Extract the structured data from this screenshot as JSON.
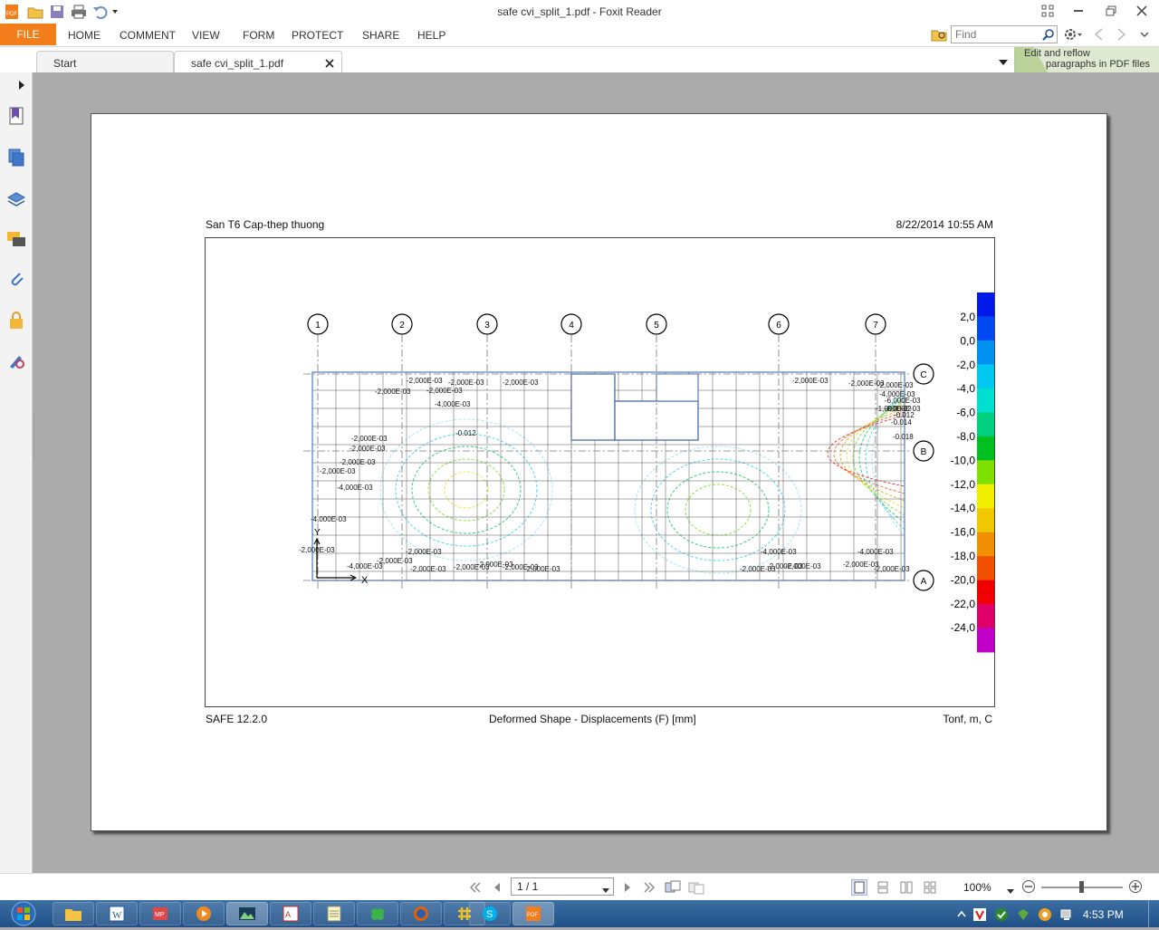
{
  "window": {
    "title": "safe cvi_split_1.pdf - Foxit Reader"
  },
  "menu": {
    "file": "FILE",
    "items": [
      "HOME",
      "COMMENT",
      "VIEW",
      "FORM",
      "PROTECT",
      "SHARE",
      "HELP"
    ],
    "find_placeholder": "Find"
  },
  "tabs": [
    {
      "label": "Start"
    },
    {
      "label": "safe cvi_split_1.pdf"
    }
  ],
  "reflow_hint": {
    "line1": "Edit and reflow",
    "line2": "paragraphs in PDF files"
  },
  "left_nav_icons": [
    "bookmark-icon",
    "pages-icon",
    "layers-icon",
    "comments-icon",
    "attachments-icon",
    "security-icon",
    "signature-icon"
  ],
  "document": {
    "header_left": "San T6 Cap-thep thuong",
    "header_right": "8/22/2014 10:55 AM",
    "footer_left": "SAFE 12.2.0",
    "footer_center": "Deformed Shape - Displacements (F)  [mm]",
    "footer_right": "Tonf, m, C",
    "grid_columns": [
      "1",
      "2",
      "3",
      "4",
      "5",
      "6",
      "7"
    ],
    "grid_rows": [
      "C",
      "B",
      "A"
    ],
    "axis_x": "X",
    "axis_y": "Y",
    "legend_values": [
      "2,0",
      "0,0",
      "-2,0",
      "-4,0",
      "-6,0",
      "-8,0",
      "-10,0",
      "-12,0",
      "-14,0",
      "-16,0",
      "-18,0",
      "-20,0",
      "-22,0",
      "-24,0"
    ],
    "legend_colors": [
      "#0018e8",
      "#0048f0",
      "#0090f0",
      "#00c8f0",
      "#00e0d0",
      "#00d080",
      "#00c020",
      "#80e000",
      "#f0f000",
      "#f0c800",
      "#f09000",
      "#f05000",
      "#f00000",
      "#e0006a",
      "#c000c8"
    ],
    "contour_labels": [
      "-2,000E-03",
      "-2,000E-03",
      "-2,000E-03",
      "-4,000E-03",
      "-2,000E-03",
      "-2,000E-03",
      "-0.012",
      "-2,000E-03",
      "-2,000E-03",
      "-2,000E-03",
      "-2,000E-03",
      "-4,000E-03",
      "-4,000E-03",
      "-2,000E-03",
      "-4,000E-03",
      "-2,000E-03",
      "-2,000E-03",
      "-2,000E-03",
      "-2,000E-03",
      "-2,000E-03",
      "-2,000E-03",
      "-2,000E-03",
      "-2,000E-03",
      "-2,000E-03",
      "-2,000E-03",
      "-4,000E-03",
      "-6,000E-03",
      "-8,000E-03",
      "-1,000E-02",
      "-0.012",
      "-0.014",
      "-0.018",
      "-4,000E-03",
      "-2,000E-03",
      "-2,000E-03",
      "-2,000E-03",
      "-4,000E-03",
      "-2,000E-03",
      "-2,000E-03"
    ]
  },
  "statusbar": {
    "page": "1 / 1",
    "zoom": "100%"
  },
  "taskbar": {
    "apps": [
      "file-explorer",
      "word",
      "media-player",
      "windows-media",
      "photo-viewer",
      "autocad",
      "notepad",
      "clover",
      "firefox",
      "grid-app",
      "skype",
      "foxit"
    ],
    "clock": "4:53 PM"
  }
}
